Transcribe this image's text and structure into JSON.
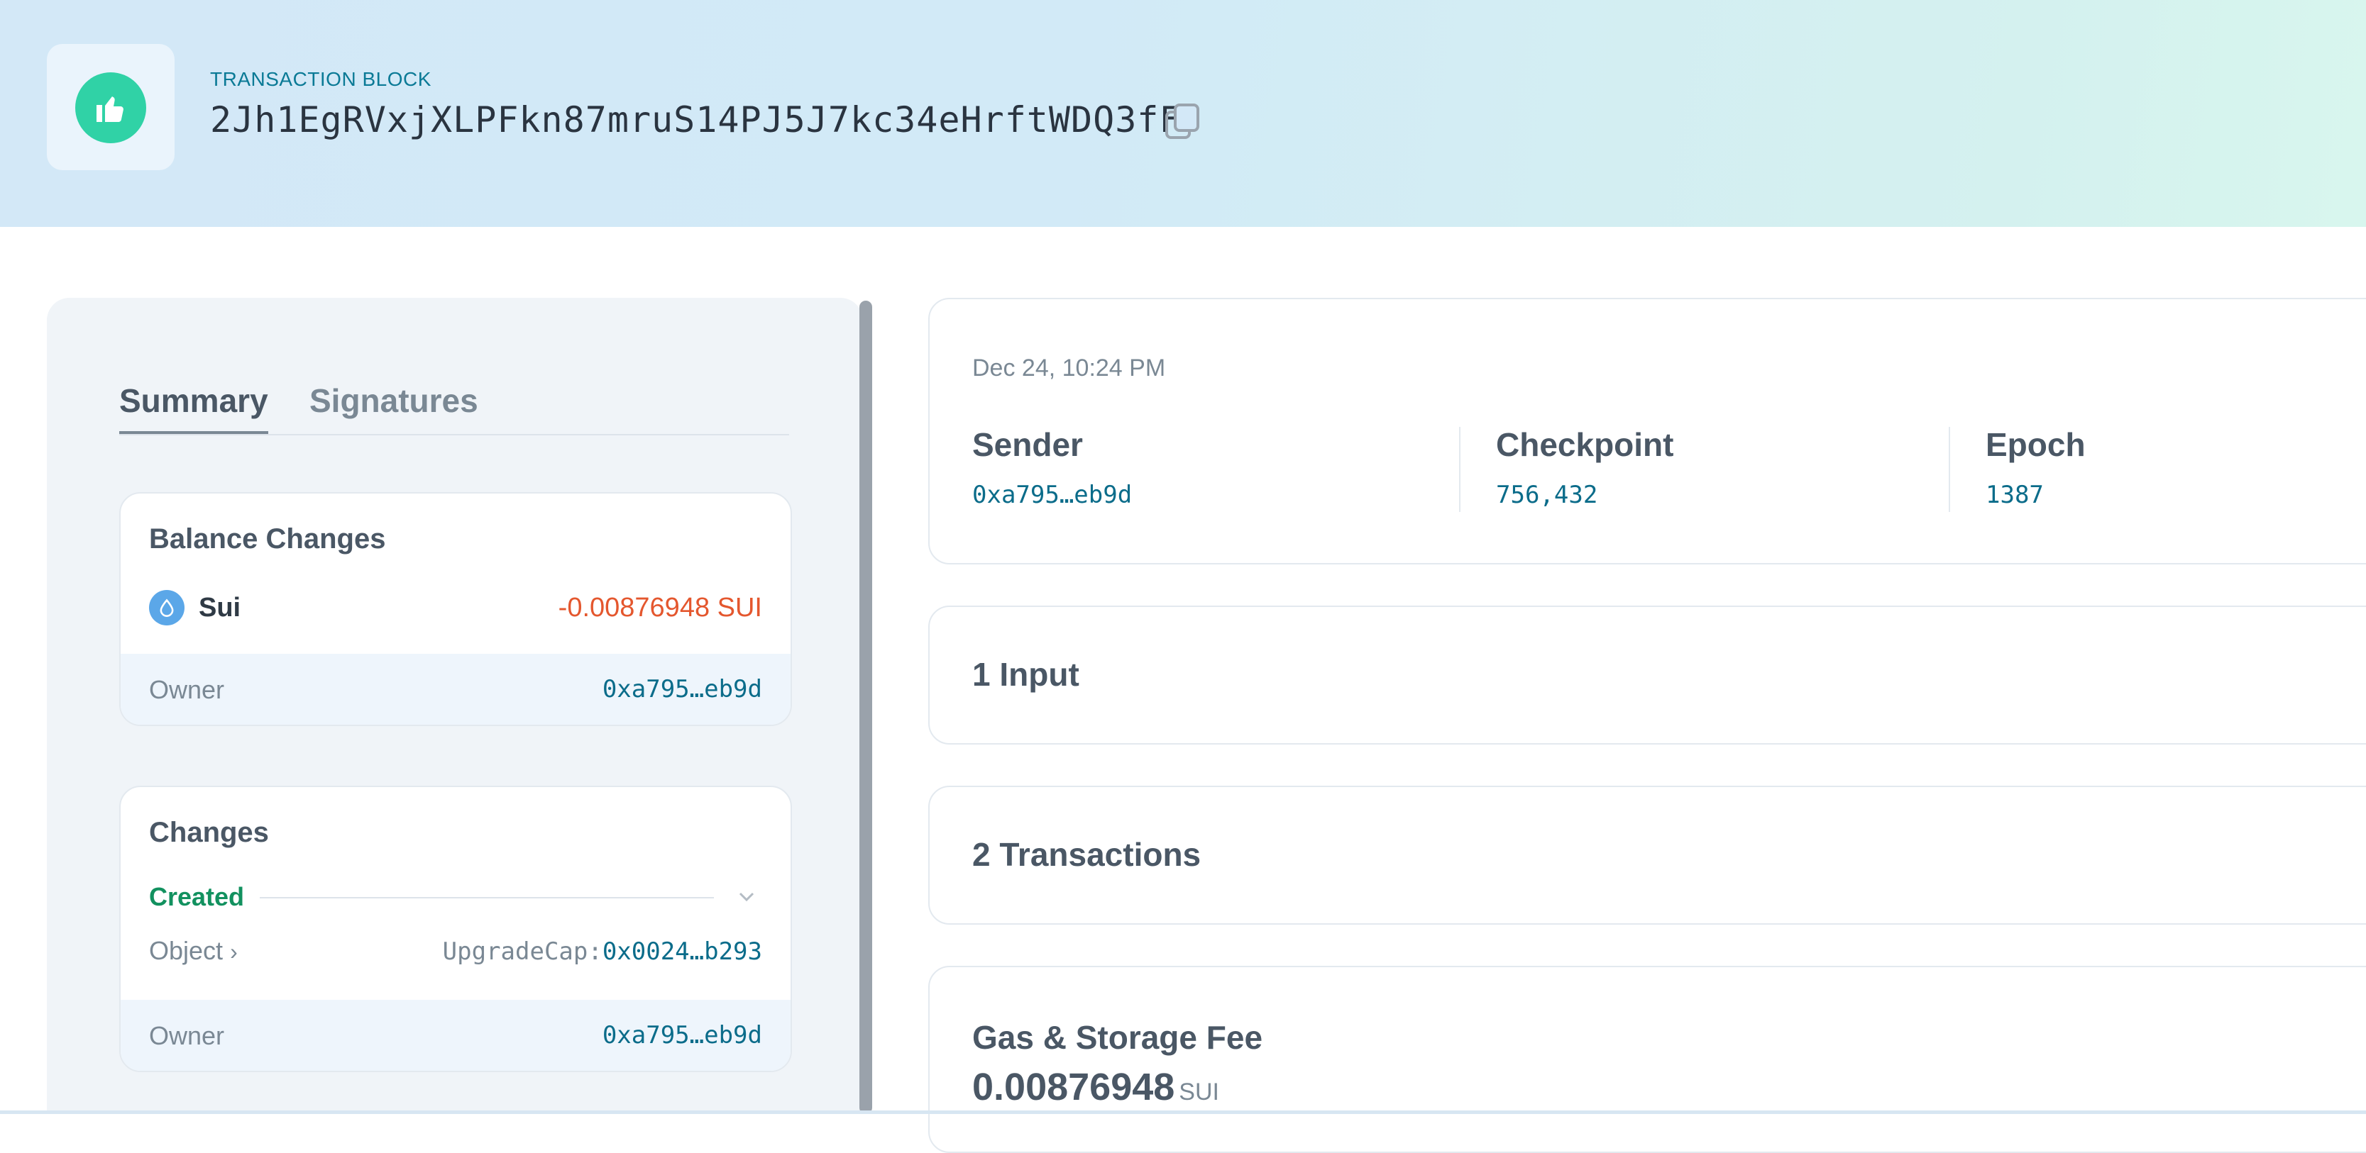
{
  "header": {
    "label": "TRANSACTION BLOCK",
    "digest": "2Jh1EgRVxjXLPFkn87mruS14PJ5J7kc34eHrftWDQ3fF",
    "status_icon": "thumbs-up-icon",
    "status_color": "#30d2a6"
  },
  "tabs": [
    {
      "label": "Summary",
      "active": true
    },
    {
      "label": "Signatures",
      "active": false
    }
  ],
  "balance_changes": {
    "title": "Balance Changes",
    "coin_name": "Sui",
    "coin_icon": "sui-drop-icon",
    "amount": "-0.00876948 SUI",
    "amount_color": "#e4572e",
    "owner_label": "Owner",
    "owner_value": "0xa795…eb9d"
  },
  "changes": {
    "title": "Changes",
    "section_label": "Created",
    "section_color": "#12915f",
    "object_label": "Object",
    "object_type": "UpgradeCap:",
    "object_id": "0x0024…b293",
    "owner_label": "Owner",
    "owner_value": "0xa795…eb9d"
  },
  "details": {
    "timestamp": "Dec 24, 10:24 PM",
    "sender_label": "Sender",
    "sender_value": "0xa795…eb9d",
    "checkpoint_label": "Checkpoint",
    "checkpoint_value": "756,432",
    "epoch_label": "Epoch",
    "epoch_value": "1387"
  },
  "inputs": {
    "title": "1 Input"
  },
  "transactions": {
    "title": "2 Transactions"
  },
  "gas": {
    "title": "Gas & Storage Fee",
    "amount": "0.00876948",
    "unit": "SUI"
  }
}
